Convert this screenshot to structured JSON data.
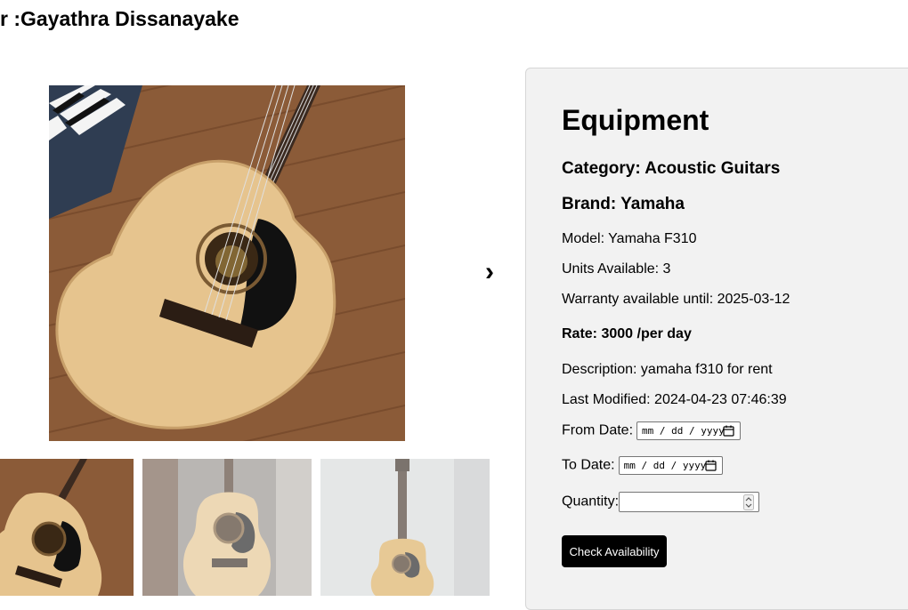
{
  "owner": {
    "heading": "r :Gayathra Dissanayake"
  },
  "gallery": {
    "next_arrow": "›"
  },
  "details": {
    "title": "Equipment",
    "category": "Category: Acoustic Guitars",
    "brand": "Brand: Yamaha",
    "model": "Model: Yamaha F310",
    "units": "Units Available: 3",
    "warranty": "Warranty available until: 2025-03-12",
    "rate": "Rate: 3000 /per day",
    "description": "Description: yamaha f310 for rent",
    "last_modified": "Last Modified: 2024-04-23 07:46:39",
    "from_date_label": "From Date:",
    "from_date_placeholder": "mm / dd / yyyy",
    "to_date_label": "To Date:",
    "to_date_placeholder": "mm / dd / yyyy",
    "quantity_label": "Quantity:",
    "quantity_value": "",
    "check_button": "Check Availability"
  }
}
